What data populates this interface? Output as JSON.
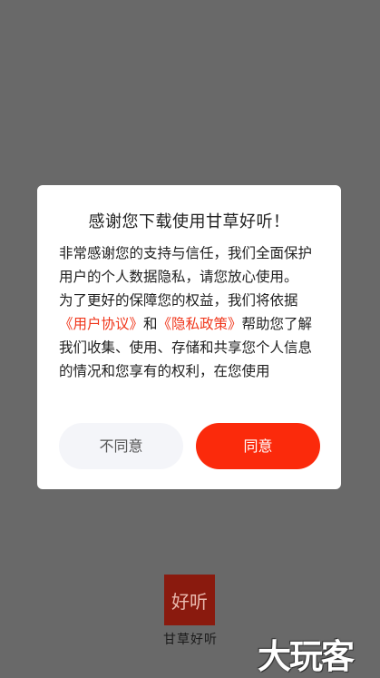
{
  "dialog": {
    "title": "感谢您下载使用甘草好听！",
    "paragraph1": "非常感谢您的支持与信任，我们全面保护用户的个人数据隐私，请您放心使用。",
    "paragraph2_before": "为了更好的保障您的权益，我们将依据",
    "user_agreement_link": "《用户协议》",
    "and_text": "和",
    "privacy_policy_link": "《隐私政策》",
    "paragraph2_after": "帮助您了解我们收集、使用、存储和共享您个人信息的情况和您享有的权利，在您使用",
    "disagree_label": "不同意",
    "agree_label": "同意"
  },
  "splash": {
    "logo_text": "好听",
    "app_name": "甘草好听"
  },
  "watermark": "大玩客",
  "colors": {
    "accent": "#fb2a0b",
    "link": "#f0371c",
    "overlay": "#696969",
    "logo_bg": "#8a1a0e"
  }
}
